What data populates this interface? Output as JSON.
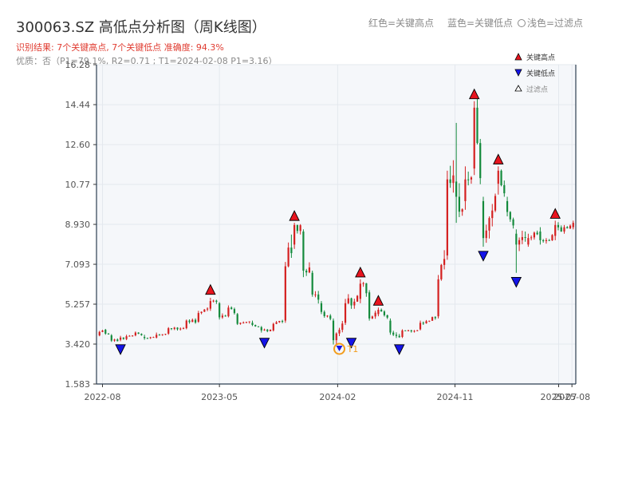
{
  "header": {
    "title": "300063.SZ 高低点分析图（周K线图）",
    "result_line": "识别结果: 7个关键高点, 7个关键低点   准确度: 94.3%",
    "quality_line": "优质：否（P1=79.1%, R2=0.71 ; T1=2024-02-08 P1=3.16）",
    "legend_top": [
      "红色=关键高点",
      "蓝色=关键低点",
      "浅色=过滤点"
    ]
  },
  "colors": {
    "up": "#d42020",
    "down": "#148a3c",
    "high_marker": "#e8141e",
    "low_marker": "#1414e8",
    "t1_ring": "#f29d1e",
    "plot_bg": "#f5f7fa",
    "grid": "#e4e8ee"
  },
  "chart_data": {
    "type": "candlestick",
    "title": "300063.SZ 高低点分析图（周K线图）",
    "y_ticks": [
      "1.583",
      "3.420",
      "5.257",
      "7.093",
      "8.930",
      "10.77",
      "12.60",
      "14.44",
      "16.28"
    ],
    "ylim": [
      1.583,
      16.28
    ],
    "x_ticks": [
      "2022-08",
      "2023-05",
      "2024-02",
      "2024-11",
      "2025-07",
      "2025-08"
    ],
    "xlim": [
      "2022-07-18",
      "2025-08-10"
    ],
    "grid": true,
    "legend": {
      "position": "top-right",
      "entries": [
        {
          "label": "关键高点",
          "marker": "triangle-up",
          "color": "#e8141e"
        },
        {
          "label": "关键低点",
          "marker": "triangle-down",
          "color": "#1414e8"
        },
        {
          "label": "过滤点",
          "marker": "triangle-up-outline",
          "color": "#ffffff"
        }
      ]
    },
    "key_highs": [
      {
        "date": "2023-04-10",
        "price": 5.6
      },
      {
        "date": "2023-10-23",
        "price": 9.0
      },
      {
        "date": "2024-03-25",
        "price": 6.4
      },
      {
        "date": "2024-05-06",
        "price": 5.1
      },
      {
        "date": "2024-12-16",
        "price": 14.6
      },
      {
        "date": "2025-02-10",
        "price": 11.6
      },
      {
        "date": "2025-06-23",
        "price": 9.1
      }
    ],
    "key_lows": [
      {
        "date": "2022-09-12",
        "price": 3.5
      },
      {
        "date": "2023-08-14",
        "price": 3.8
      },
      {
        "date": "2024-03-04",
        "price": 3.8
      },
      {
        "date": "2024-06-24",
        "price": 3.5
      },
      {
        "date": "2025-01-06",
        "price": 7.8
      },
      {
        "date": "2025-03-24",
        "price": 6.6
      }
    ],
    "t1": {
      "label": "T1",
      "date": "2024-02-05",
      "price": 3.2
    },
    "candles": [
      [
        "2022-07-25",
        3.82,
        3.98,
        4.03,
        3.78
      ],
      [
        "2022-08-08",
        4.08,
        3.9,
        4.12,
        3.85
      ],
      [
        "2022-08-22",
        3.82,
        3.58,
        3.88,
        3.52
      ],
      [
        "2022-09-12",
        3.62,
        3.72,
        3.8,
        3.55
      ],
      [
        "2022-09-26",
        3.65,
        3.78,
        3.85,
        3.6
      ],
      [
        "2022-10-17",
        3.82,
        3.95,
        4.0,
        3.78
      ],
      [
        "2022-11-07",
        3.75,
        3.7,
        3.85,
        3.62
      ],
      [
        "2022-12-05",
        3.72,
        3.85,
        3.95,
        3.68
      ],
      [
        "2023-01-02",
        3.9,
        4.15,
        4.2,
        3.85
      ],
      [
        "2023-02-13",
        4.15,
        4.5,
        4.55,
        4.1
      ],
      [
        "2023-03-13",
        4.45,
        4.85,
        4.95,
        4.4
      ],
      [
        "2023-04-10",
        5.05,
        5.4,
        5.55,
        4.95
      ],
      [
        "2023-05-01",
        5.3,
        4.65,
        5.35,
        4.55
      ],
      [
        "2023-05-22",
        4.7,
        5.1,
        5.2,
        4.65
      ],
      [
        "2023-06-12",
        4.8,
        4.35,
        4.85,
        4.3
      ],
      [
        "2023-07-17",
        4.4,
        4.3,
        4.5,
        4.25
      ],
      [
        "2023-08-07",
        4.2,
        4.05,
        4.25,
        3.95
      ],
      [
        "2023-09-04",
        4.05,
        4.35,
        4.4,
        4.0
      ],
      [
        "2023-10-02",
        4.5,
        7.0,
        7.2,
        4.4
      ],
      [
        "2023-10-23",
        8.0,
        8.9,
        9.0,
        7.8
      ],
      [
        "2023-11-13",
        8.6,
        6.8,
        8.7,
        6.5
      ],
      [
        "2023-12-04",
        6.7,
        5.7,
        6.8,
        5.6
      ],
      [
        "2023-12-25",
        5.3,
        4.9,
        5.4,
        4.8
      ],
      [
        "2024-01-22",
        4.5,
        3.6,
        4.6,
        3.4
      ],
      [
        "2024-02-19",
        4.4,
        5.3,
        5.5,
        4.3
      ],
      [
        "2024-03-25",
        5.5,
        6.2,
        6.4,
        5.3
      ],
      [
        "2024-04-15",
        5.8,
        4.6,
        5.9,
        4.5
      ],
      [
        "2024-05-06",
        4.8,
        5.0,
        5.1,
        4.7
      ],
      [
        "2024-06-03",
        4.5,
        3.95,
        4.6,
        3.85
      ],
      [
        "2024-07-01",
        3.75,
        4.05,
        4.1,
        3.7
      ],
      [
        "2024-08-12",
        4.1,
        4.4,
        4.5,
        4.05
      ],
      [
        "2024-09-23",
        4.7,
        6.4,
        6.6,
        4.6
      ],
      [
        "2024-10-14",
        7.5,
        11.0,
        11.4,
        7.3
      ],
      [
        "2024-11-04",
        10.9,
        10.2,
        13.6,
        9.0
      ],
      [
        "2024-11-25",
        10.0,
        11.0,
        11.6,
        9.6
      ],
      [
        "2024-12-16",
        11.5,
        14.3,
        14.6,
        11.2
      ],
      [
        "2025-01-06",
        10.0,
        8.3,
        10.2,
        7.9
      ],
      [
        "2025-02-10",
        10.8,
        11.4,
        11.6,
        10.3
      ],
      [
        "2025-03-03",
        10.0,
        9.5,
        10.2,
        9.3
      ],
      [
        "2025-03-24",
        8.5,
        8.0,
        8.7,
        6.7
      ],
      [
        "2025-04-21",
        8.0,
        8.3,
        8.5,
        7.9
      ],
      [
        "2025-05-19",
        8.6,
        8.2,
        8.8,
        8.0
      ],
      [
        "2025-06-23",
        8.4,
        8.9,
        9.1,
        8.2
      ],
      [
        "2025-07-14",
        8.6,
        8.8,
        8.9,
        8.5
      ],
      [
        "2025-08-04",
        8.8,
        9.0,
        9.1,
        8.7
      ]
    ]
  }
}
